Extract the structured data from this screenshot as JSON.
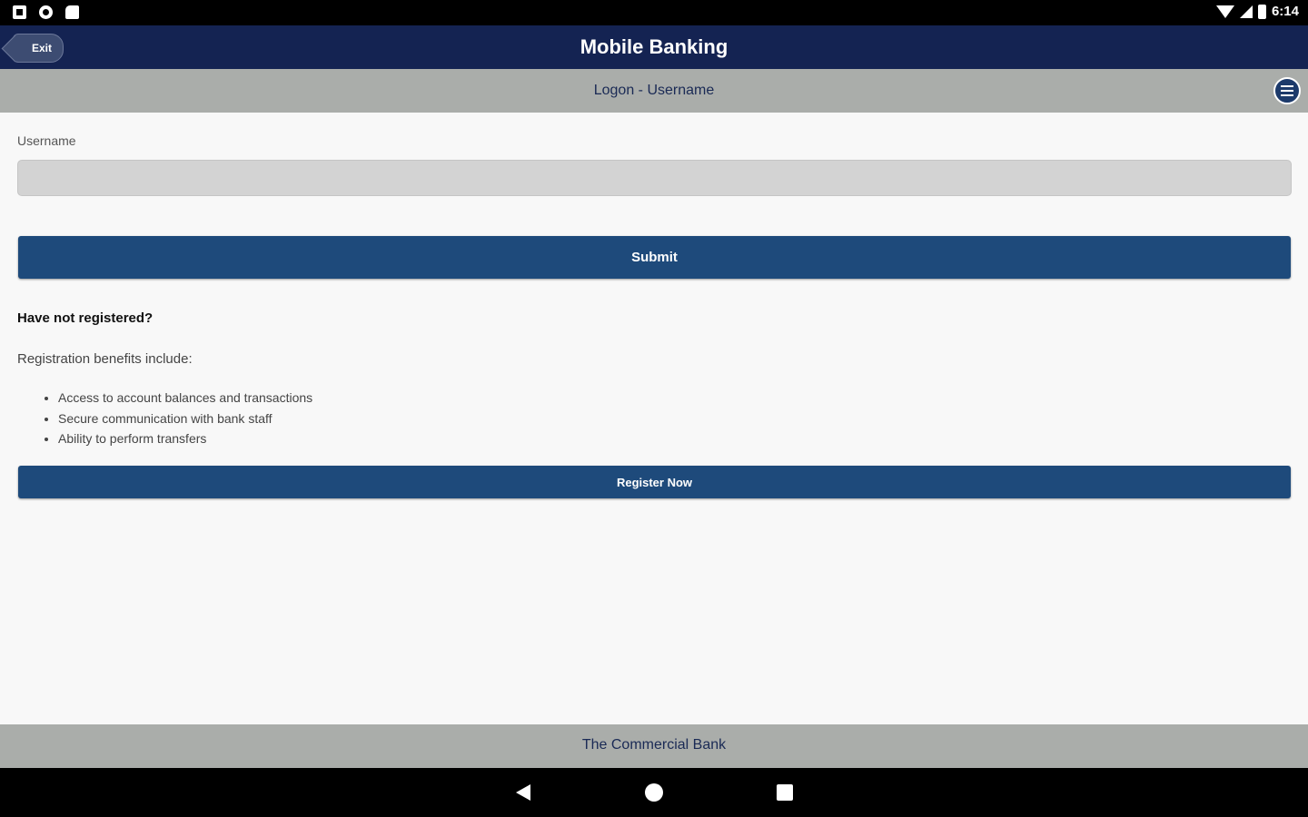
{
  "status_bar": {
    "time": "6:14"
  },
  "header": {
    "exit_label": "Exit",
    "title": "Mobile Banking"
  },
  "subheader": {
    "title": "Logon - Username"
  },
  "form": {
    "username_label": "Username",
    "username_value": "",
    "submit_label": "Submit"
  },
  "registration": {
    "heading": "Have not registered?",
    "intro": "Registration benefits include:",
    "benefits": [
      "Access to account balances and transactions",
      "Secure communication with bank staff",
      "Ability to perform transfers"
    ],
    "register_label": "Register Now"
  },
  "footer": {
    "text": "The Commercial Bank"
  },
  "colors": {
    "header_bg": "#142352",
    "button_bg": "#1e4a7b",
    "band_bg": "#aaadaa"
  }
}
